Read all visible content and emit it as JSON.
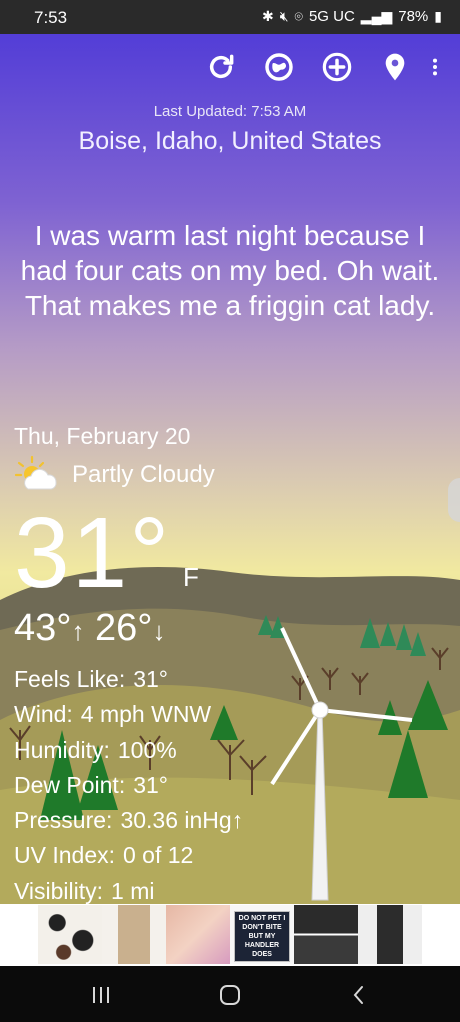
{
  "status_bar": {
    "time": "7:53",
    "network": "5G UC",
    "battery": "78%",
    "icons": [
      "bluetooth-icon",
      "mute-icon",
      "location-icon",
      "signal-icon",
      "battery-icon"
    ]
  },
  "toolbar": {
    "buttons": [
      "refresh-icon",
      "radar-icon",
      "add-location-icon",
      "location-pin-icon",
      "more-icon"
    ]
  },
  "header": {
    "last_updated": "Last Updated: 7:53 AM",
    "location": "Boise, Idaho, United States"
  },
  "quote": "I was warm last night because I had four cats on my bed. Oh wait. That makes me a friggin cat lady.",
  "current": {
    "date": "Thu, February 20",
    "condition": "Partly Cloudy",
    "condition_icon": "partly-cloudy-icon",
    "temperature": "31°",
    "unit": "F",
    "high": "43°",
    "high_arrow": "↑",
    "low": "26°",
    "low_arrow": "↓"
  },
  "details": [
    {
      "label": "Feels Like:",
      "value": "31°"
    },
    {
      "label": "Wind:",
      "value": "4 mph WNW"
    },
    {
      "label": "Humidity:",
      "value": "100%"
    },
    {
      "label": "Dew Point:",
      "value": "31°"
    },
    {
      "label": "Pressure:",
      "value": "30.36 inHg↑"
    },
    {
      "label": "UV Index:",
      "value": "0 of 12"
    },
    {
      "label": "Visibility:",
      "value": "1 mi"
    }
  ],
  "ad": {
    "patch_text": "DO NOT PET I DON'T BITE BUT MY HANDLER DOES"
  },
  "nav_bar": {
    "buttons": [
      "recents-icon",
      "home-icon",
      "back-icon"
    ]
  },
  "colors": {
    "sky_top": "#4a36d8",
    "sky_bottom": "#f1e9a0",
    "hill_far": "#6b6b52",
    "hill_near": "#9c9254",
    "tree": "#2f7a3a"
  }
}
